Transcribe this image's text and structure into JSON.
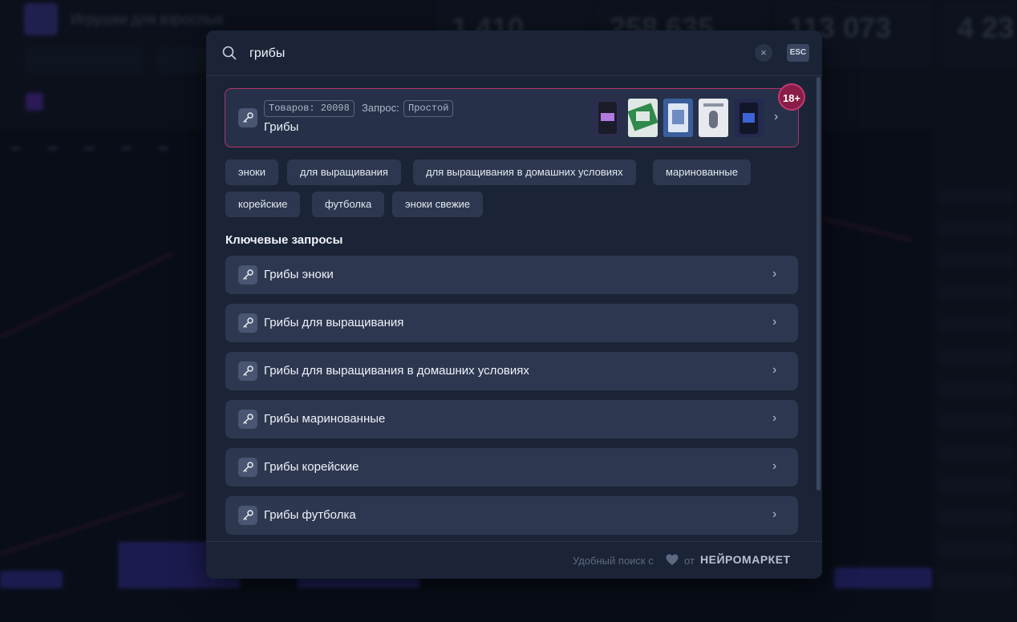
{
  "search": {
    "query": "грибы",
    "clear_label": "×",
    "esc_label": "ESC"
  },
  "top_result": {
    "products_label": "Товаров: 20098",
    "query_label": "Запрос:",
    "query_type": "Простой",
    "title": "Грибы",
    "age_badge": "18+"
  },
  "suggestions": [
    "эноки",
    "для выращивания",
    "для выращивания в домашних условиях",
    "маринованные",
    "корейские",
    "футболка",
    "эноки свежие"
  ],
  "key_queries": {
    "title": "Ключевые запросы",
    "items": [
      "Грибы эноки",
      "Грибы для выращивания",
      "Грибы для выращивания в домашних условиях",
      "Грибы маринованные",
      "Грибы корейские",
      "Грибы футболка"
    ]
  },
  "footer": {
    "text": "Удобный поиск с",
    "from": "от",
    "brand": "НЕЙРОМАРКЕТ"
  },
  "background": {
    "app_title": "Игрушки для взрослых",
    "stats": [
      "1 410",
      "258 635",
      "113 073",
      "4 23"
    ]
  },
  "colors": {
    "accent_border": "#b3336b",
    "badge": "#8a1d48",
    "card": "#2d3850",
    "modal": "#1b2436"
  }
}
